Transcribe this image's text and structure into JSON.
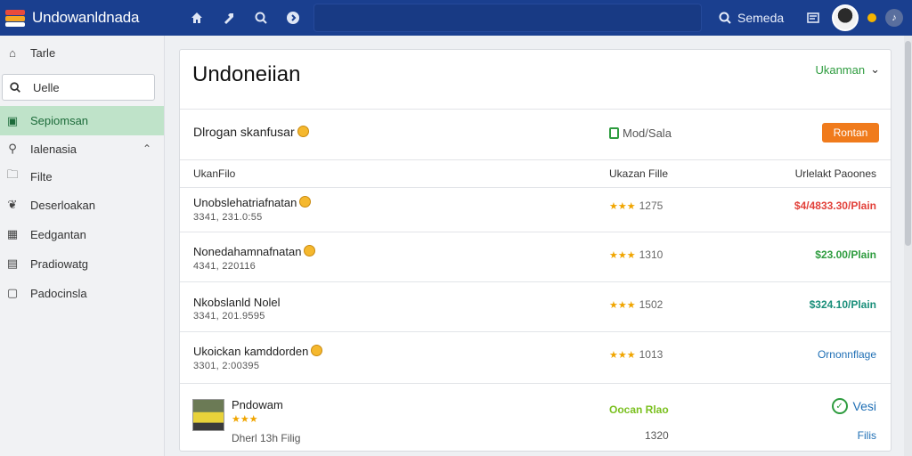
{
  "header": {
    "app_title": "Undowanldnada",
    "search_label": "Semeda",
    "icons": [
      "home-icon",
      "tool-icon",
      "search-icon",
      "info-icon",
      "search-icon",
      "list-icon",
      "avatar",
      "notification-dot",
      "music-icon"
    ],
    "colors": {
      "bar": "#1a3f8f"
    }
  },
  "sidebar": {
    "items": [
      {
        "label": "Tarle",
        "icon": "home-icon"
      },
      {
        "label": "Uelle",
        "icon": "search-icon"
      },
      {
        "label": "Sepiomsan",
        "icon": "image-icon",
        "active": true
      },
      {
        "label": "Ialenasia",
        "icon": "location-icon",
        "expandable": true
      },
      {
        "label": "Filte",
        "icon": "folder-icon"
      },
      {
        "label": "Deserloakan",
        "icon": "leaf-icon"
      },
      {
        "label": "Eedgantan",
        "icon": "calendar-icon"
      },
      {
        "label": "Pradiowatg",
        "icon": "card-icon"
      },
      {
        "label": "Padocinsla",
        "icon": "document-icon"
      }
    ],
    "colors": {
      "active_bg": "#bfe3c9"
    }
  },
  "main": {
    "title": "Undoneiian",
    "dropdown": "Ukanman",
    "info": {
      "label": "Dlrogan skanfusar",
      "file_text": "Mod/Sala",
      "button": "Rontan"
    },
    "columns": {
      "name": "UkanFilo",
      "rating": "Ukazan Fille",
      "price": "Urlelakt Paoones"
    },
    "rows": [
      {
        "name": "Unobslehatriafnatan",
        "sub": "3341, 231.0:55",
        "stars": "★★★",
        "rating": "1275",
        "price": "$4/4833.30/Plain",
        "price_color": "red"
      },
      {
        "name": "Nonedahamnafnatan",
        "sub": "4341, 220116",
        "stars": "★★★",
        "rating": "1310",
        "price": "$23.00/Plain",
        "price_color": "green"
      },
      {
        "name": "Nkobslanld Nolel",
        "sub": "3341, 201.9595",
        "stars": "★★★",
        "rating": "1502",
        "price": "$324.10/Plain",
        "price_color": "teal"
      },
      {
        "name": "Ukoickan kamddorden",
        "sub": "3301, 2:00395",
        "stars": "★★★",
        "rating": "1013",
        "price": "Ornonnflage",
        "price_color": "blue"
      }
    ],
    "last_row": {
      "name": "Pndowam",
      "stars": "★★★",
      "foot": "Dherl 13h Filig",
      "center_label": "Oocan Rlao",
      "center_num": "1320",
      "visit": "Vesi",
      "files": "Filis"
    }
  }
}
